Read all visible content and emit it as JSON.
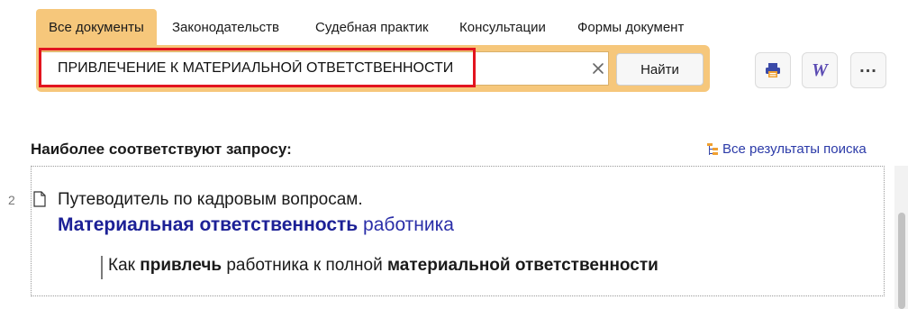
{
  "tabs": [
    {
      "label": "Все документы",
      "active": true
    },
    {
      "label": "Законодательств"
    },
    {
      "label": "Судебная практик"
    },
    {
      "label": "Консультации"
    },
    {
      "label": "Формы документ"
    }
  ],
  "search": {
    "value": "ПРИВЛЕЧЕНИЕ К МАТЕРИАЛЬНОЙ ОТВЕТСТВЕННОСТИ",
    "find_label": "Найти"
  },
  "toolbar": {
    "print_icon": "printer-icon",
    "word_icon": "word-export-icon",
    "word_glyph": "W",
    "more_icon": "more-icon",
    "more_glyph": "..."
  },
  "results": {
    "section_title": "Наиболее соответствуют запросу:",
    "all_results_label": "Все результаты поиска",
    "items": [
      {
        "number": "2",
        "line1": "Путеводитель по кадровым вопросам.",
        "title_strong": "Материальная ответственность",
        "title_rest": " работника",
        "snippet_parts": [
          "Как ",
          "привлечь",
          " работника к полной ",
          "материальной ответственности"
        ]
      }
    ]
  },
  "colors": {
    "tab_active": "#f6c77b",
    "highlight": "#e2141f",
    "link": "#1c2096"
  }
}
